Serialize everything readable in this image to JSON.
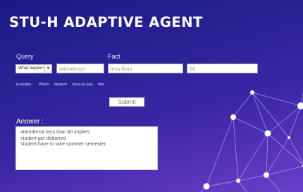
{
  "app": {
    "title": "STU-H ADAPTIVE AGENT"
  },
  "form": {
    "query_label": "Query",
    "fact_label": "Fact",
    "query_select_value": "What happen",
    "subject_value": "attendence",
    "predicate_value": "less-than",
    "value_value": "60",
    "example_prefix": "Example :",
    "example_tokens": [
      "When",
      "student",
      "have-to-pay",
      "fine"
    ],
    "submit_label": "Submit"
  },
  "answer": {
    "label": "Answer :",
    "lines": [
      "attendence less than 60 implies",
      "student get debarred",
      "student have to take summer semester."
    ]
  },
  "colors": {
    "bg_top": "#1c1a86",
    "bg_bottom": "#6a3fc9",
    "network_line": "#c9bdf5"
  }
}
